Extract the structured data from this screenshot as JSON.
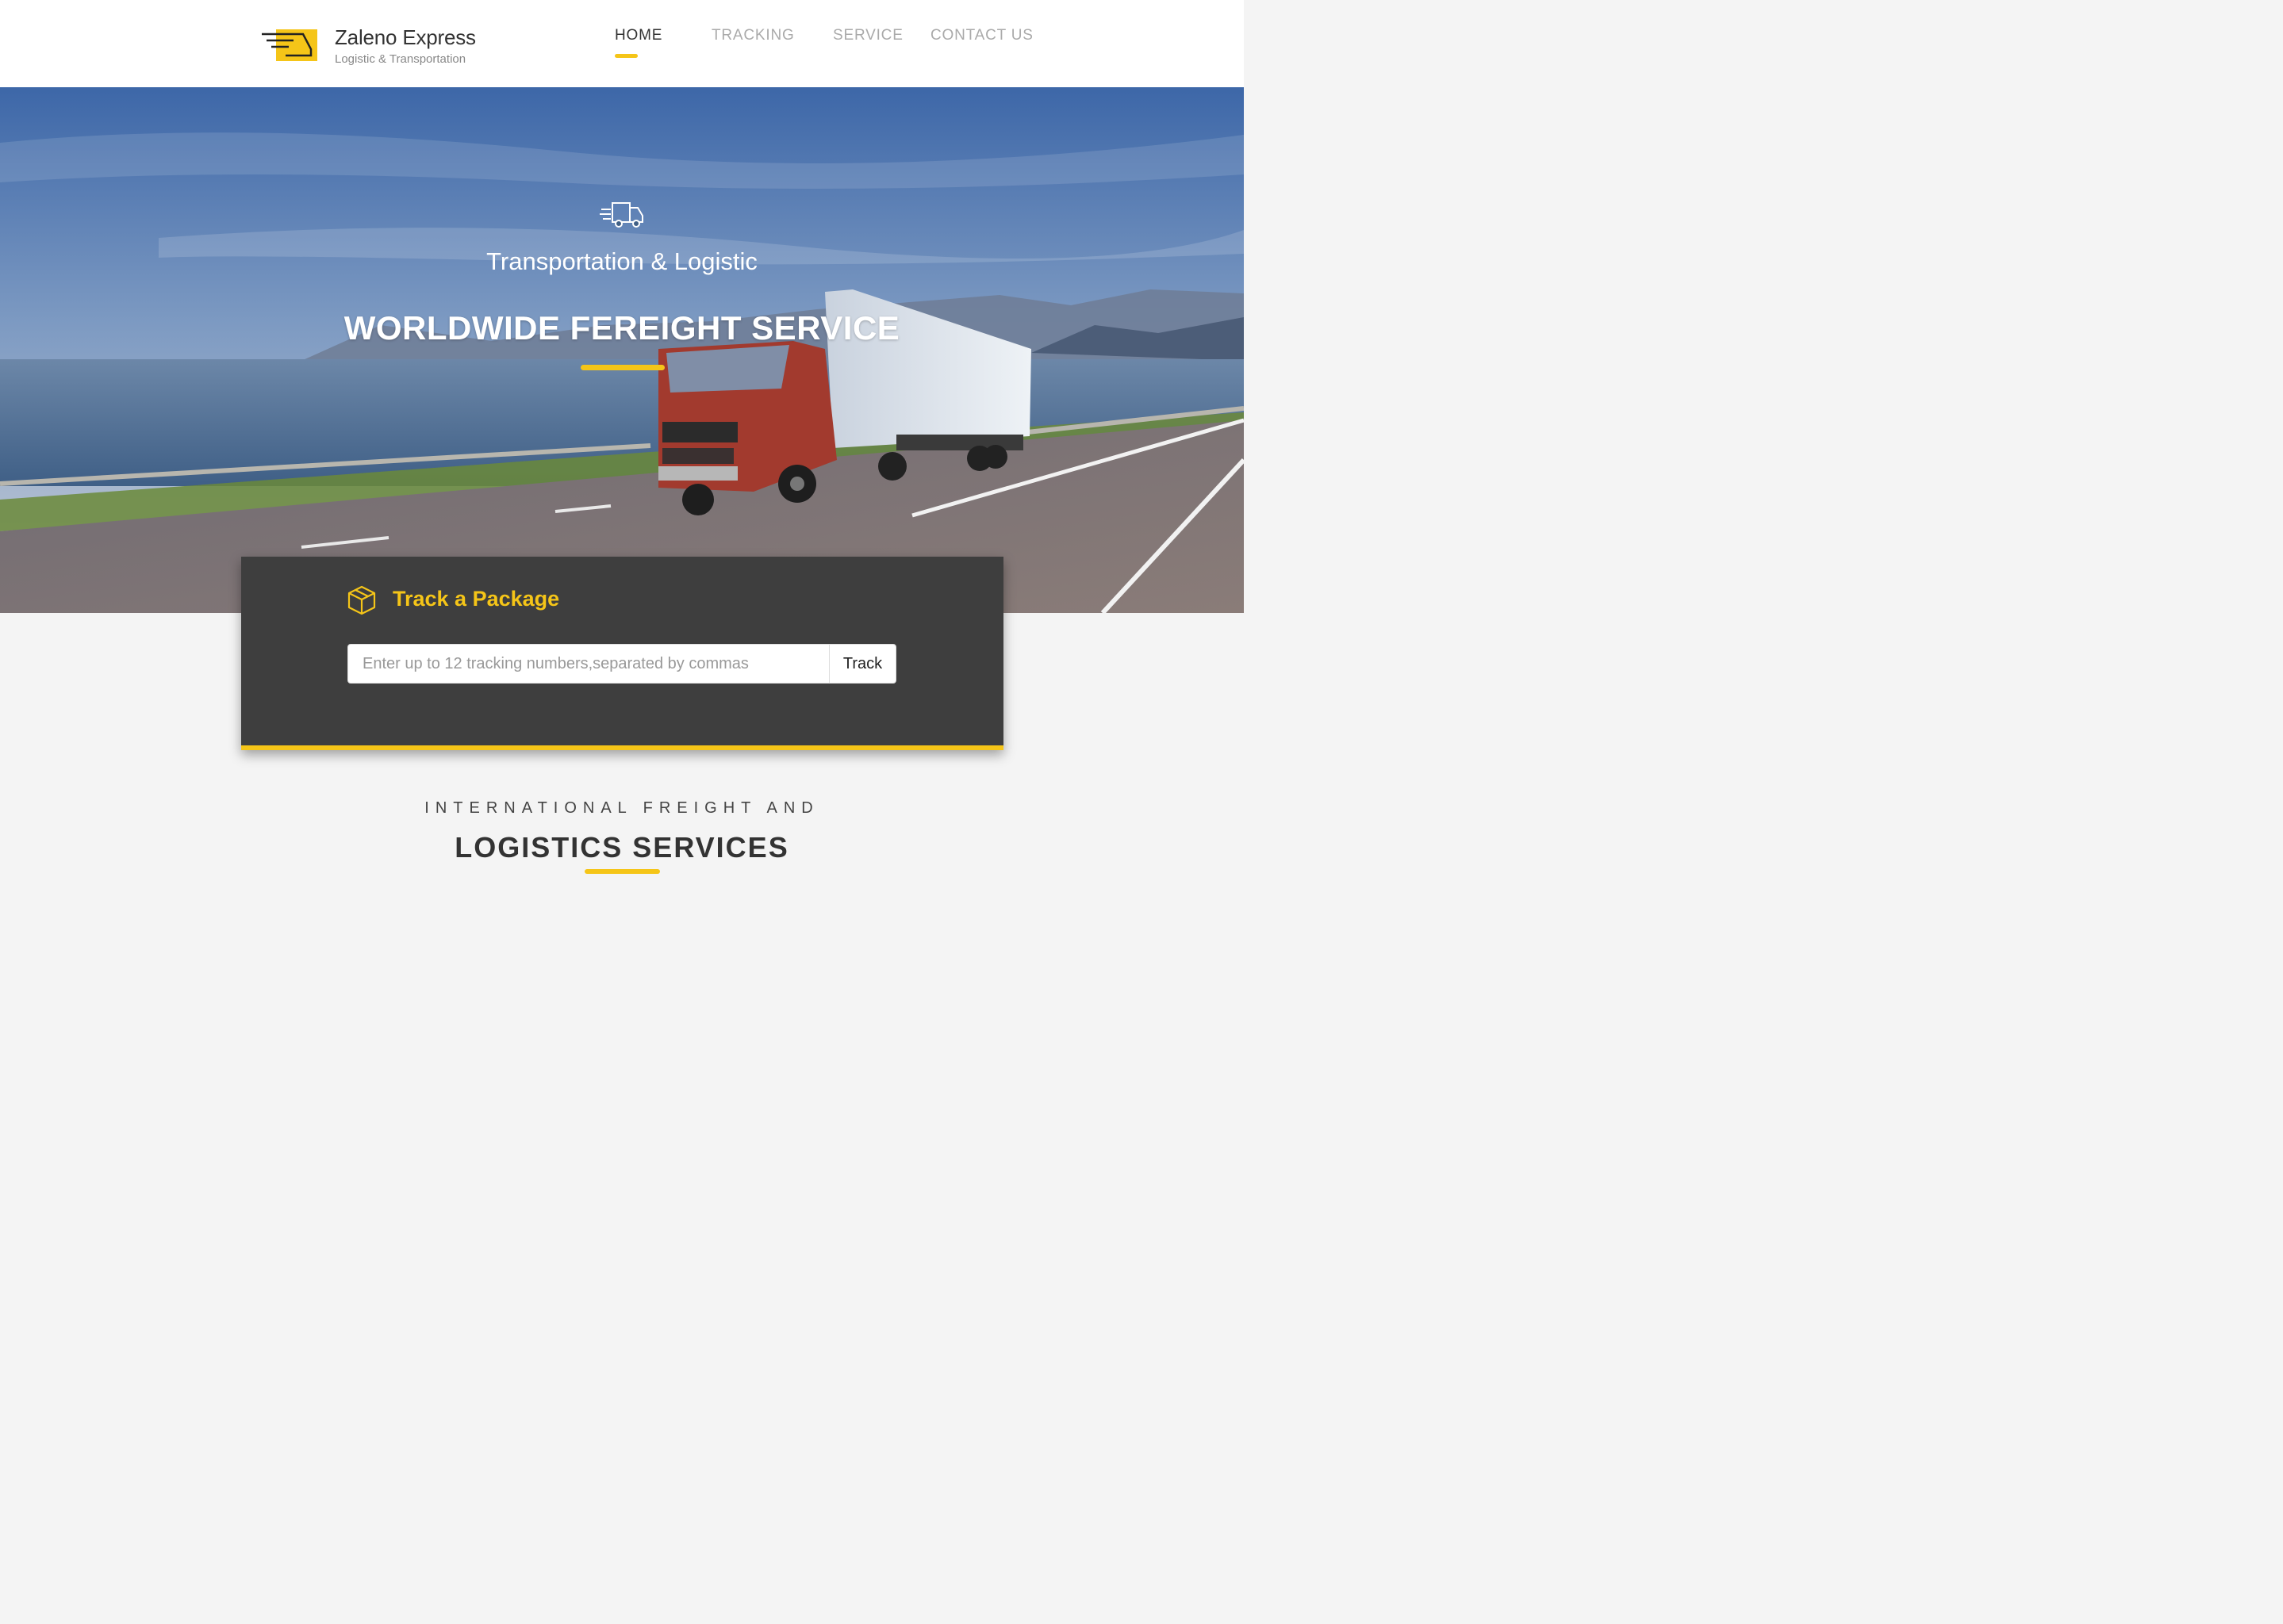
{
  "brand": {
    "name": "Zaleno Express",
    "tagline": "Logistic & Transportation"
  },
  "nav": {
    "items": [
      {
        "label": "HOME",
        "active": true
      },
      {
        "label": "TRACKING",
        "active": false
      },
      {
        "label": "SERVICE",
        "active": false
      },
      {
        "label": "CONTACT US",
        "active": false
      }
    ]
  },
  "hero": {
    "icon": "delivery-truck-icon",
    "subtitle": "Transportation & Logistic",
    "title": "WORLDWIDE FEREIGHT SERVICE"
  },
  "track": {
    "icon": "package-box-icon",
    "title": "Track a Package",
    "placeholder": "Enter up to 12 tracking numbers,separated by commas",
    "value": "",
    "button_label": "Track"
  },
  "section": {
    "kicker": "INTERNATIONAL FREIGHT AND",
    "title": "LOGISTICS SERVICES"
  },
  "colors": {
    "accent": "#f5c518",
    "panel": "#3e3e3e",
    "text_dark": "#333333",
    "nav_inactive": "#aaaaaa"
  }
}
